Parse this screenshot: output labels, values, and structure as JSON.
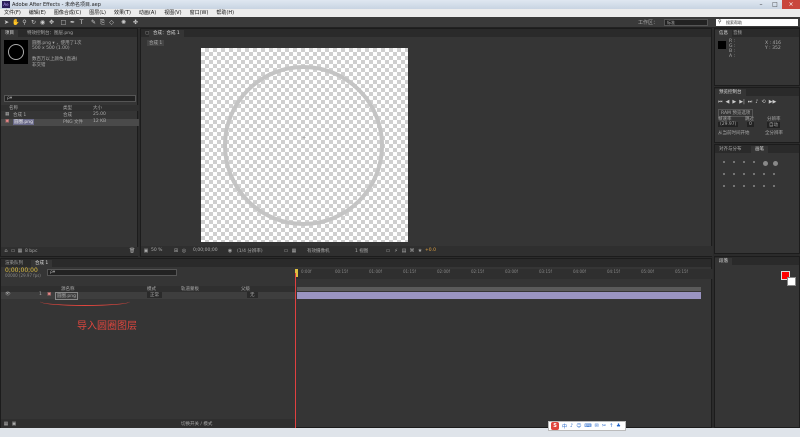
{
  "window": {
    "title": "Adobe After Effects - 未命名项目.aep",
    "controls": [
      "–",
      "□",
      "×"
    ]
  },
  "menu": [
    "文件(F)",
    "编辑(E)",
    "图像合成(C)",
    "图层(L)",
    "效果(T)",
    "动画(A)",
    "视图(V)",
    "窗口(W)",
    "帮助(H)"
  ],
  "toolbar": {
    "workspace_label": "工作区：",
    "workspace_value": "标准",
    "search_placeholder": "搜索帮助"
  },
  "project": {
    "tabs": [
      "项目",
      "特效控制台：图层.png"
    ],
    "file_name": "圆圈.png ▾ ，使用了1次",
    "file_dims": "500 x 500 (1.00)",
    "file_info_1": "数百万以上颜色 (直通)",
    "file_info_2": "非交错",
    "search_placeholder": "ρ▾",
    "columns": {
      "name": "名称",
      "type": "类型",
      "size": "大小"
    },
    "items": [
      {
        "name": "合成 1",
        "type": "合成",
        "size": "25.00"
      },
      {
        "name": "圆圈.png",
        "type": "PNG 文件",
        "size": "12 KB"
      }
    ],
    "bpc": "8 bpc"
  },
  "composition": {
    "tab": "合成：合成 1",
    "subtab": "合成 1",
    "zoom": "50 %",
    "timecode": "0;00;00;00",
    "resolution": "(1/4 分辨率)",
    "camera": "有效摄像机",
    "views": "1 视图",
    "exposure": "+0.0"
  },
  "info": {
    "tabs": [
      "信息",
      "音频"
    ],
    "r": "R :",
    "g": "G :",
    "b": "B :",
    "a": "A :",
    "x": "X : 416",
    "y": "Y : 352"
  },
  "preview": {
    "title": "预览控制台",
    "ram_options": "RAM 预览选项",
    "frame_rate": "帧速率",
    "skip": "跳过",
    "resolution": "分辨率",
    "fps_value": "(29.97)",
    "skip_value": "0",
    "res_value": "自动",
    "from_current": "从当前时间开始",
    "full_screen": "全分辨率"
  },
  "align": {
    "tabs": [
      "对齐与分布",
      "画笔"
    ]
  },
  "paragraph": {
    "tabs": [
      "段落"
    ]
  },
  "timeline": {
    "tabs": [
      "渲染队列",
      "合成 1"
    ],
    "timecode": "0;00;00;00",
    "fps": "00000 (29.97 fps)",
    "search_placeholder": "ρ▾",
    "col_source": "源名称",
    "col_mode": "模式",
    "col_trkmat": "轨道蒙板",
    "col_parent": "父级",
    "layer": {
      "num": "1",
      "name": "圆圈.png",
      "mode": "正常",
      "parent": "无"
    },
    "ruler": [
      "0:00f",
      "00:15f",
      "01:00f",
      "01:15f",
      "02:00f",
      "02:15f",
      "03:00f",
      "03:15f",
      "04:00f",
      "04:15f",
      "05:00f",
      "05:15f"
    ],
    "toggle": "切换开关 / 模式"
  },
  "annotation": "导入圆圈图层",
  "ime": {
    "logo": "S",
    "items": [
      "中",
      "♪",
      "☺",
      "⌨",
      "✉",
      "✂",
      "↑",
      "♣"
    ]
  }
}
